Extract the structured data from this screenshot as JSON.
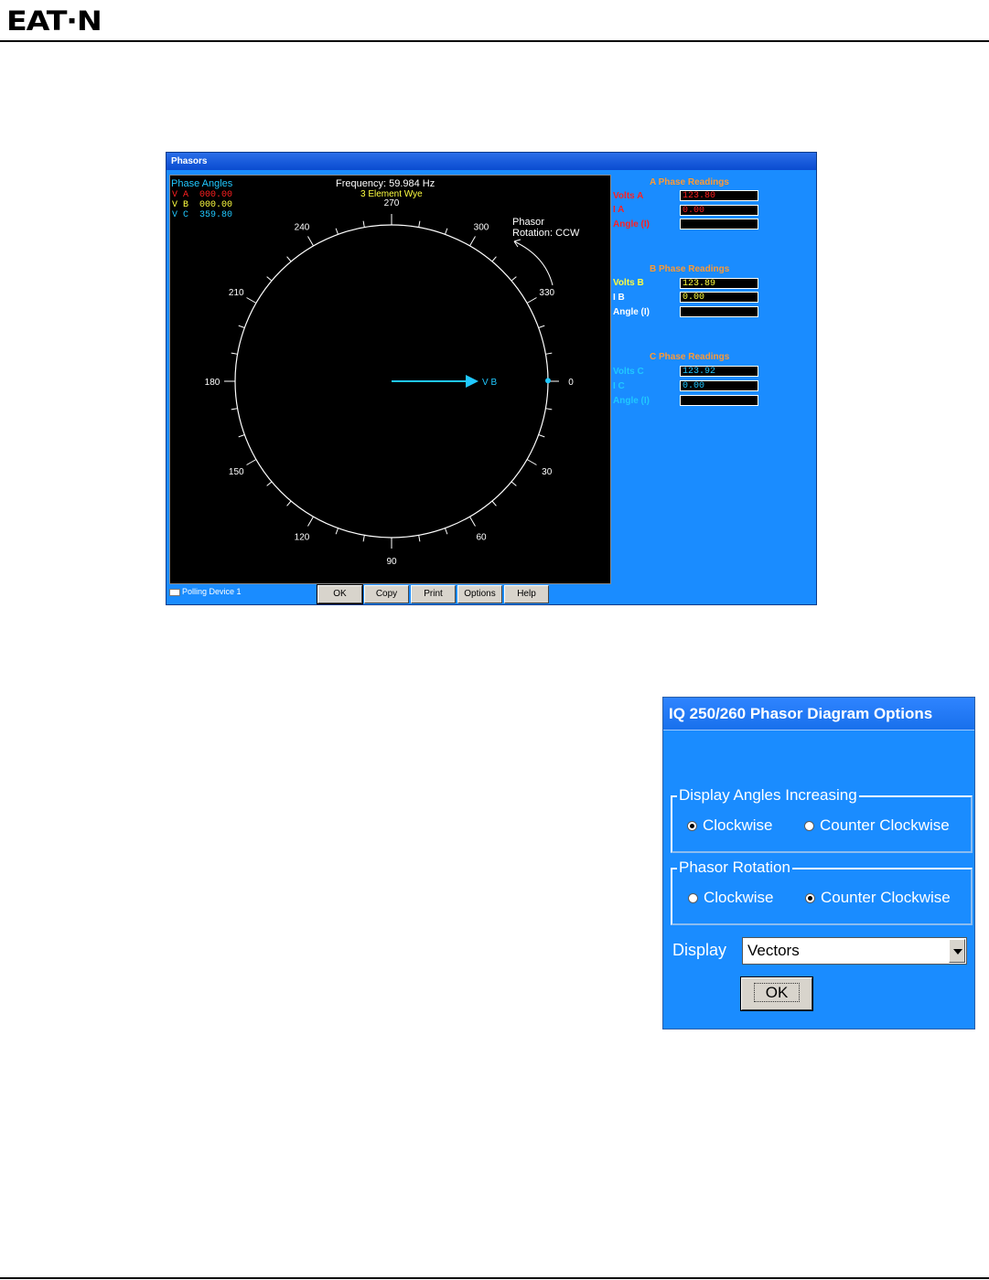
{
  "logo": "EAT·N",
  "phasors_window": {
    "title": "Phasors",
    "phase_angles_label": "Phase Angles",
    "phase_angles": [
      {
        "label": "V A",
        "value": "000.00",
        "color": "#ff2020"
      },
      {
        "label": "V B",
        "value": "000.00",
        "color": "#ffff40"
      },
      {
        "label": "V C",
        "value": "359.80",
        "color": "#20c8ff"
      }
    ],
    "frequency": "Frequency: 59.984 Hz",
    "element": "3 Element Wye",
    "rotation_line1": "Phasor",
    "rotation_line2": "Rotation: CCW",
    "dial_labels": [
      "0",
      "30",
      "60",
      "90",
      "120",
      "150",
      "180",
      "210",
      "240",
      "270",
      "300",
      "330"
    ],
    "vector_label": "V B",
    "readings": {
      "a": {
        "heading": "A Phase Readings",
        "color": "#ff2020",
        "volts_label": "Volts A",
        "volts": "123.80",
        "i_label": "I A",
        "i": "0.00",
        "angle_label": "Angle (I)",
        "angle": ""
      },
      "b": {
        "heading": "B Phase Readings",
        "color": "#ffff40",
        "volts_label": "Volts B",
        "volts": "123.89",
        "i_label": "I B",
        "i": "0.00",
        "angle_label": "Angle (I)",
        "angle": ""
      },
      "c": {
        "heading": "C Phase Readings",
        "color": "#20c8ff",
        "volts_label": "Volts C",
        "volts": "123.92",
        "i_label": "I C",
        "i": "0.00",
        "angle_label": "Angle (I)",
        "angle": ""
      }
    },
    "status": "Polling Device 1",
    "buttons": {
      "ok": "OK",
      "copy": "Copy",
      "print": "Print",
      "options": "Options",
      "help": "Help"
    }
  },
  "options_dialog": {
    "title": "IQ 250/260 Phasor Diagram Options",
    "angles_group": "Display Angles Increasing",
    "angles_cw": "Clockwise",
    "angles_ccw": "Counter Clockwise",
    "angles_selected": "Clockwise",
    "rotation_group": "Phasor Rotation",
    "rotation_cw": "Clockwise",
    "rotation_ccw": "Counter Clockwise",
    "rotation_selected": "Counter Clockwise",
    "display_label": "Display",
    "display_value": "Vectors",
    "ok": "OK"
  }
}
